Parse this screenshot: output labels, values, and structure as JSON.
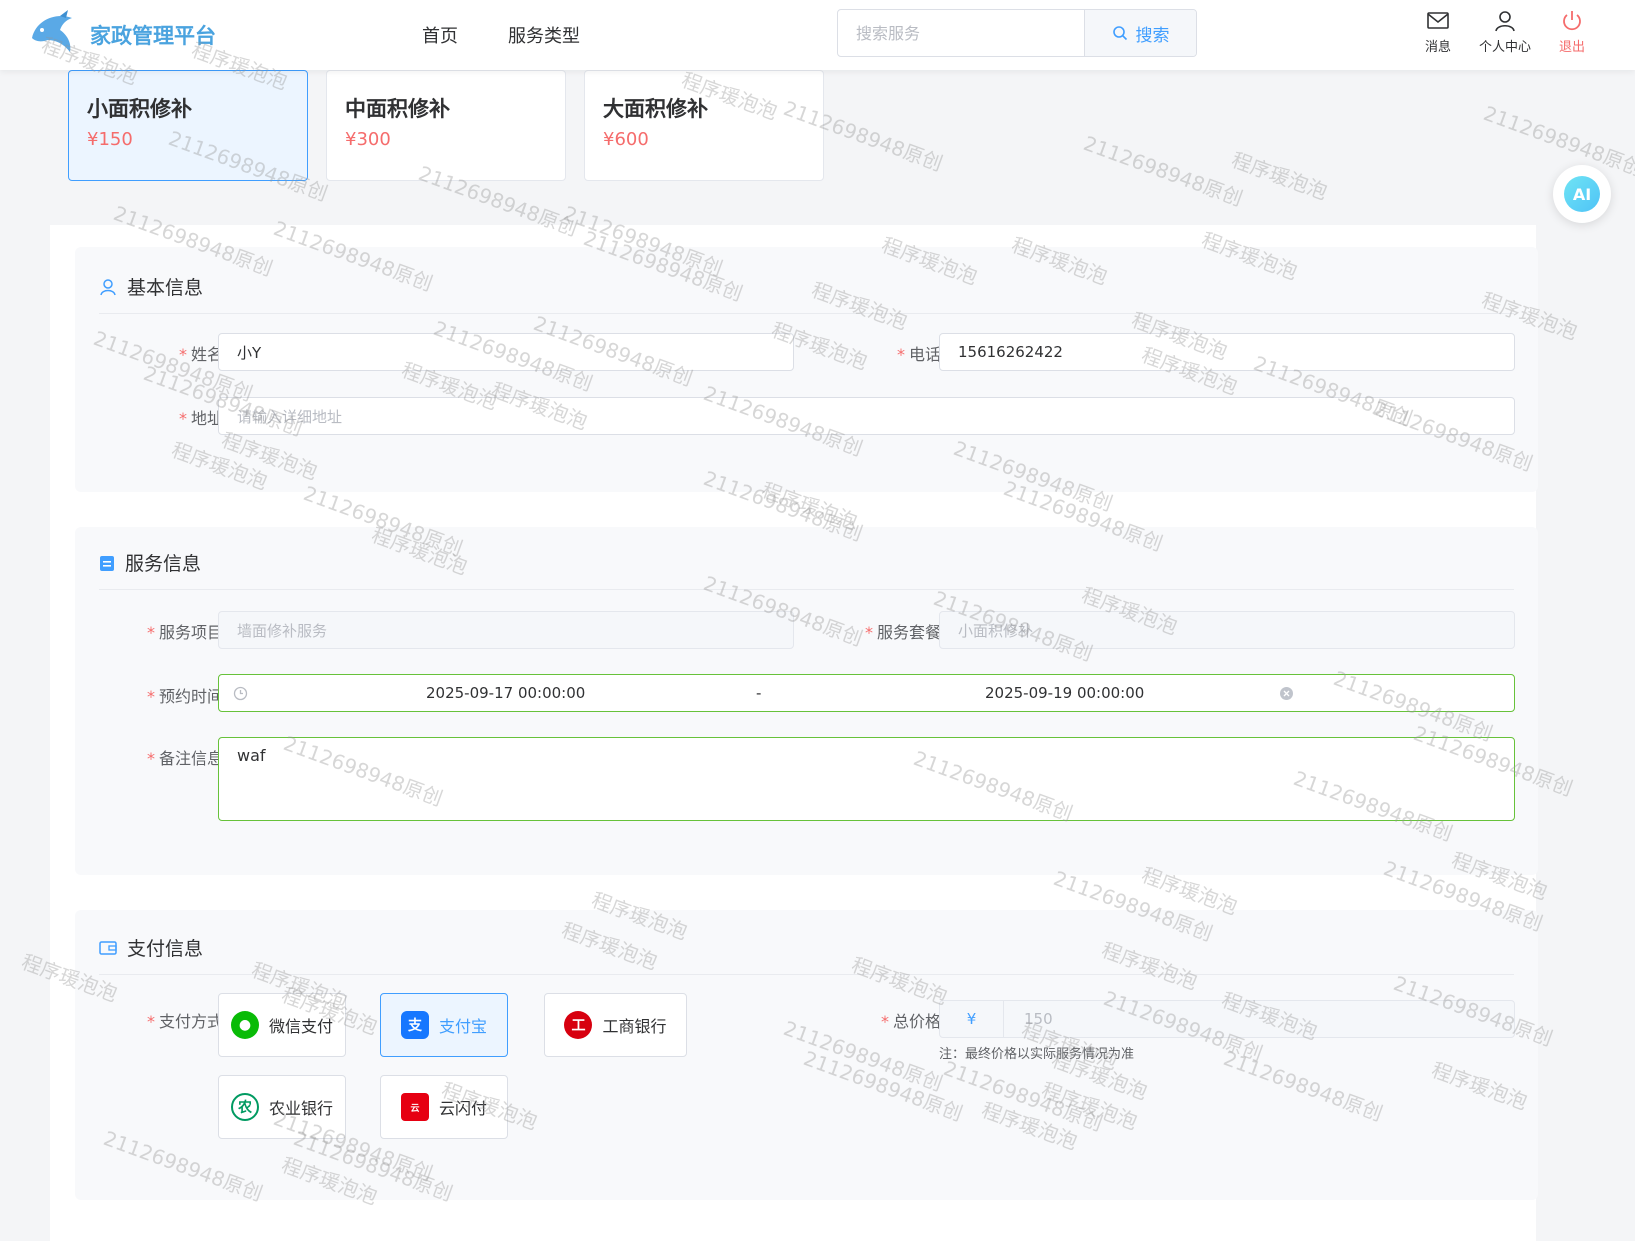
{
  "header": {
    "brand": "家政管理平台",
    "nav": [
      "首页",
      "服务类型"
    ],
    "search": {
      "placeholder": "搜索服务",
      "button": "搜索"
    },
    "tools": {
      "message": "消息",
      "profile": "个人中心",
      "logout": "退出"
    }
  },
  "packages": [
    {
      "name": "小面积修补",
      "price": "¥150",
      "selected": true
    },
    {
      "name": "中面积修补",
      "price": "¥300",
      "selected": false
    },
    {
      "name": "大面积修补",
      "price": "¥600",
      "selected": false
    }
  ],
  "ai_button": "AI",
  "basic_info": {
    "title": "基本信息",
    "name_label": "姓名",
    "name_value": "小Y",
    "phone_label": "电话",
    "phone_value": "15616262422",
    "address_label": "地址",
    "address_placeholder": "请输入详细地址"
  },
  "service_info": {
    "title": "服务信息",
    "item_label": "服务项目",
    "item_value": "墙面修补服务",
    "package_label": "服务套餐",
    "package_value": "小面积修补",
    "time_label": "预约时间",
    "start_time": "2025-09-17 00:00:00",
    "range_separator": "-",
    "end_time": "2025-09-19 00:00:00",
    "remark_label": "备注信息",
    "remark_value": "waf"
  },
  "payment_info": {
    "title": "支付信息",
    "method_label": "支付方式",
    "methods": [
      {
        "label": "微信支付",
        "icon": "wechat-pay-icon",
        "selected": false
      },
      {
        "label": "支付宝",
        "icon": "alipay-icon",
        "selected": true
      },
      {
        "label": "工商银行",
        "icon": "icbc-icon",
        "selected": false
      },
      {
        "label": "农业银行",
        "icon": "abc-bank-icon",
        "selected": false
      },
      {
        "label": "云闪付",
        "icon": "unionpay-quickpass-icon",
        "selected": false
      }
    ],
    "total_label": "总价格",
    "currency": "¥",
    "total_value": "150",
    "note": "注：最终价格以实际服务情况为准"
  },
  "watermark": {
    "text_a": "程序瑗泡泡",
    "text_b": "2112698948原创"
  },
  "colors": {
    "primary": "#409eff",
    "danger": "#f56c6c",
    "success": "#67c23a",
    "brand": "#4aa3df"
  }
}
